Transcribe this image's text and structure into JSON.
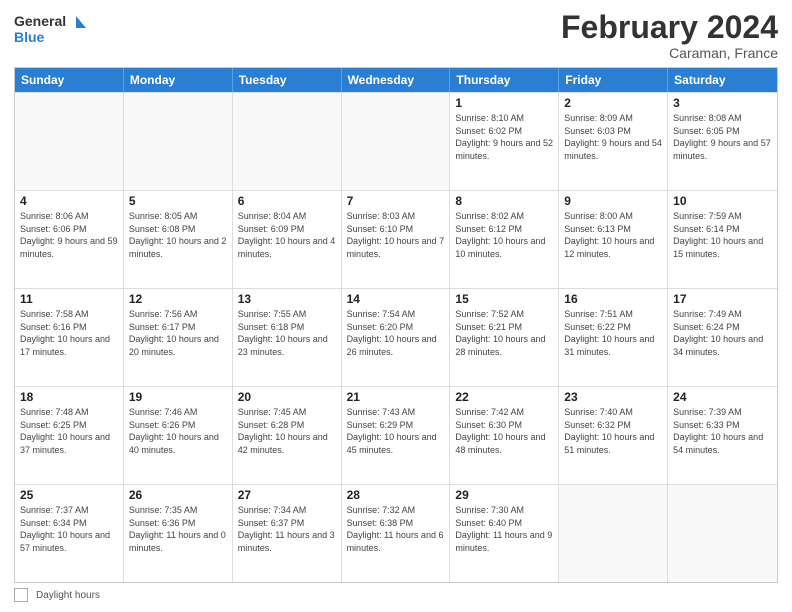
{
  "header": {
    "logo_line1": "General",
    "logo_line2": "Blue",
    "main_title": "February 2024",
    "subtitle": "Caraman, France"
  },
  "calendar": {
    "days_of_week": [
      "Sunday",
      "Monday",
      "Tuesday",
      "Wednesday",
      "Thursday",
      "Friday",
      "Saturday"
    ],
    "rows": [
      [
        {
          "day": "",
          "info": ""
        },
        {
          "day": "",
          "info": ""
        },
        {
          "day": "",
          "info": ""
        },
        {
          "day": "",
          "info": ""
        },
        {
          "day": "1",
          "info": "Sunrise: 8:10 AM\nSunset: 6:02 PM\nDaylight: 9 hours and 52 minutes."
        },
        {
          "day": "2",
          "info": "Sunrise: 8:09 AM\nSunset: 6:03 PM\nDaylight: 9 hours and 54 minutes."
        },
        {
          "day": "3",
          "info": "Sunrise: 8:08 AM\nSunset: 6:05 PM\nDaylight: 9 hours and 57 minutes."
        }
      ],
      [
        {
          "day": "4",
          "info": "Sunrise: 8:06 AM\nSunset: 6:06 PM\nDaylight: 9 hours and 59 minutes."
        },
        {
          "day": "5",
          "info": "Sunrise: 8:05 AM\nSunset: 6:08 PM\nDaylight: 10 hours and 2 minutes."
        },
        {
          "day": "6",
          "info": "Sunrise: 8:04 AM\nSunset: 6:09 PM\nDaylight: 10 hours and 4 minutes."
        },
        {
          "day": "7",
          "info": "Sunrise: 8:03 AM\nSunset: 6:10 PM\nDaylight: 10 hours and 7 minutes."
        },
        {
          "day": "8",
          "info": "Sunrise: 8:02 AM\nSunset: 6:12 PM\nDaylight: 10 hours and 10 minutes."
        },
        {
          "day": "9",
          "info": "Sunrise: 8:00 AM\nSunset: 6:13 PM\nDaylight: 10 hours and 12 minutes."
        },
        {
          "day": "10",
          "info": "Sunrise: 7:59 AM\nSunset: 6:14 PM\nDaylight: 10 hours and 15 minutes."
        }
      ],
      [
        {
          "day": "11",
          "info": "Sunrise: 7:58 AM\nSunset: 6:16 PM\nDaylight: 10 hours and 17 minutes."
        },
        {
          "day": "12",
          "info": "Sunrise: 7:56 AM\nSunset: 6:17 PM\nDaylight: 10 hours and 20 minutes."
        },
        {
          "day": "13",
          "info": "Sunrise: 7:55 AM\nSunset: 6:18 PM\nDaylight: 10 hours and 23 minutes."
        },
        {
          "day": "14",
          "info": "Sunrise: 7:54 AM\nSunset: 6:20 PM\nDaylight: 10 hours and 26 minutes."
        },
        {
          "day": "15",
          "info": "Sunrise: 7:52 AM\nSunset: 6:21 PM\nDaylight: 10 hours and 28 minutes."
        },
        {
          "day": "16",
          "info": "Sunrise: 7:51 AM\nSunset: 6:22 PM\nDaylight: 10 hours and 31 minutes."
        },
        {
          "day": "17",
          "info": "Sunrise: 7:49 AM\nSunset: 6:24 PM\nDaylight: 10 hours and 34 minutes."
        }
      ],
      [
        {
          "day": "18",
          "info": "Sunrise: 7:48 AM\nSunset: 6:25 PM\nDaylight: 10 hours and 37 minutes."
        },
        {
          "day": "19",
          "info": "Sunrise: 7:46 AM\nSunset: 6:26 PM\nDaylight: 10 hours and 40 minutes."
        },
        {
          "day": "20",
          "info": "Sunrise: 7:45 AM\nSunset: 6:28 PM\nDaylight: 10 hours and 42 minutes."
        },
        {
          "day": "21",
          "info": "Sunrise: 7:43 AM\nSunset: 6:29 PM\nDaylight: 10 hours and 45 minutes."
        },
        {
          "day": "22",
          "info": "Sunrise: 7:42 AM\nSunset: 6:30 PM\nDaylight: 10 hours and 48 minutes."
        },
        {
          "day": "23",
          "info": "Sunrise: 7:40 AM\nSunset: 6:32 PM\nDaylight: 10 hours and 51 minutes."
        },
        {
          "day": "24",
          "info": "Sunrise: 7:39 AM\nSunset: 6:33 PM\nDaylight: 10 hours and 54 minutes."
        }
      ],
      [
        {
          "day": "25",
          "info": "Sunrise: 7:37 AM\nSunset: 6:34 PM\nDaylight: 10 hours and 57 minutes."
        },
        {
          "day": "26",
          "info": "Sunrise: 7:35 AM\nSunset: 6:36 PM\nDaylight: 11 hours and 0 minutes."
        },
        {
          "day": "27",
          "info": "Sunrise: 7:34 AM\nSunset: 6:37 PM\nDaylight: 11 hours and 3 minutes."
        },
        {
          "day": "28",
          "info": "Sunrise: 7:32 AM\nSunset: 6:38 PM\nDaylight: 11 hours and 6 minutes."
        },
        {
          "day": "29",
          "info": "Sunrise: 7:30 AM\nSunset: 6:40 PM\nDaylight: 11 hours and 9 minutes."
        },
        {
          "day": "",
          "info": ""
        },
        {
          "day": "",
          "info": ""
        }
      ]
    ]
  },
  "footer": {
    "daylight_label": "Daylight hours"
  }
}
